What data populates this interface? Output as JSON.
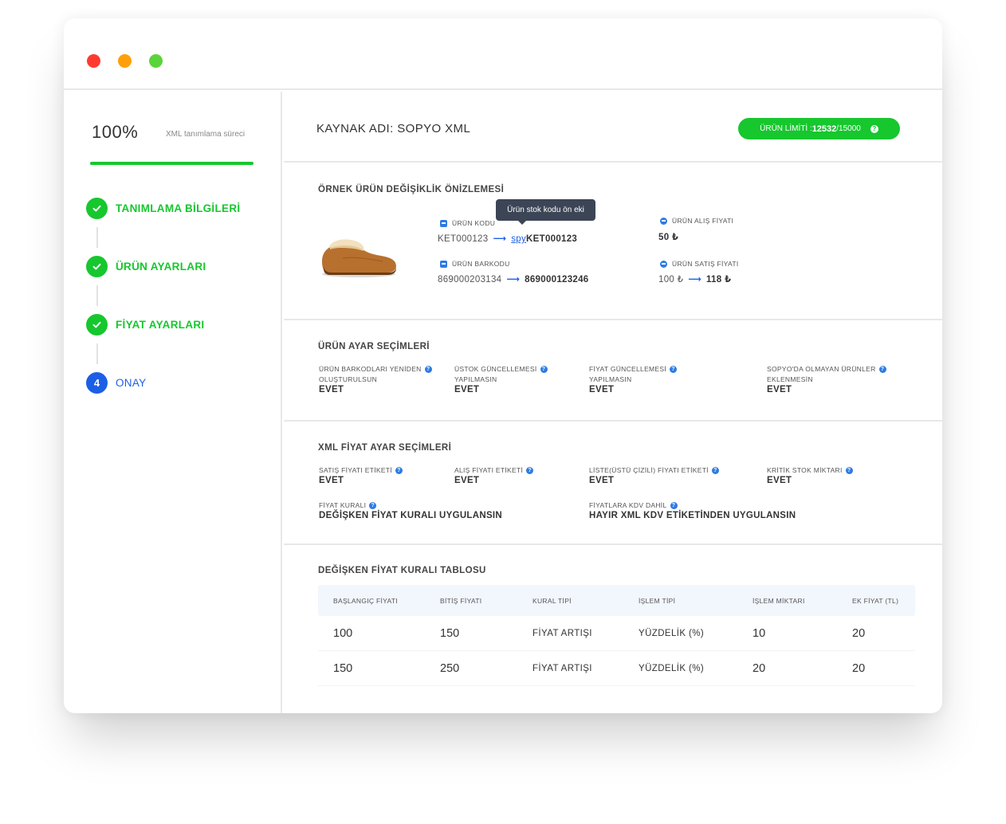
{
  "window": {
    "controls": [
      "close",
      "minimize",
      "maximize"
    ]
  },
  "sidebar": {
    "progress_percent": "100%",
    "progress_value": 100,
    "progress_label": "XML tanımlama süreci",
    "steps": [
      {
        "label": "TANIMLAMA BİLGİLERİ",
        "state": "done"
      },
      {
        "label": "ÜRÜN AYARLARI",
        "state": "done"
      },
      {
        "label": "FİYAT AYARLARI",
        "state": "done"
      },
      {
        "number": "4",
        "label": "ONAY",
        "state": "current"
      }
    ]
  },
  "header": {
    "source_title": "KAYNAK ADI: SOPYO XML",
    "limit_label": "ÜRÜN LİMİTİ : ",
    "limit_used": "12532",
    "limit_total": "/15000"
  },
  "preview": {
    "title": "ÖRNEK ÜRÜN DEĞİŞİKLİK ÖNİZLEMESİ",
    "tooltip": "Ürün stok kodu ön eki",
    "product_code": {
      "label": "ÜRÜN KODU",
      "old": "KET000123",
      "prefix": "spy",
      "new": "KET000123"
    },
    "barcode": {
      "label": "ÜRÜN BARKODU",
      "old": "869000203134",
      "new": "869000123246"
    },
    "purchase_price": {
      "label": "ÜRÜN ALIŞ FİYATI",
      "value": "50 ₺"
    },
    "sale_price": {
      "label": "ÜRÜN SATIŞ FİYATI",
      "old": "100 ₺",
      "new": "118 ₺"
    }
  },
  "product_settings": {
    "title": "ÜRÜN AYAR SEÇİMLERİ",
    "items": [
      {
        "label1": "ÜRÜN BARKODLARI YENİDEN",
        "label2": "OLUŞTURULSUN",
        "value": "EVET"
      },
      {
        "label1": "ÜSTOK GÜNCELLEMESİ",
        "label2": "YAPILMASIN",
        "value": "EVET"
      },
      {
        "label1": "FİYAT GÜNCELLEMESİ",
        "label2": "YAPILMASIN",
        "value": "EVET"
      },
      {
        "label1": "SOPYO'DA OLMAYAN ÜRÜNLER",
        "label2": "EKLENMESİN",
        "value": "EVET"
      }
    ]
  },
  "price_settings": {
    "title": "XML FİYAT AYAR SEÇİMLERİ",
    "items": [
      {
        "label": "SATIŞ FİYATI ETİKETİ",
        "value": "EVET"
      },
      {
        "label": "ALIŞ FİYATI ETİKETİ",
        "value": "EVET"
      },
      {
        "label": "LİSTE(ÜSTÜ ÇİZİLİ) FİYATI ETİKETİ",
        "value": "EVET"
      },
      {
        "label": "KRİTİK STOK MİKTARI",
        "value": "EVET"
      },
      {
        "label": "FİYAT KURALI",
        "value": "DEĞİŞKEN FİYAT KURALI UYGULANSIN"
      },
      {
        "label": "FİYATLARA KDV DAHİL",
        "value": "HAYIR XML KDV ETİKETİNDEN UYGULANSIN"
      }
    ]
  },
  "rule_table": {
    "title": "DEĞİŞKEN FİYAT KURALI TABLOSU",
    "columns": [
      "BAŞLANGIÇ FİYATI",
      "BİTİŞ FİYATI",
      "KURAL TİPİ",
      "İŞLEM TİPİ",
      "İŞLEM MİKTARI",
      "EK FİYAT (TL)"
    ],
    "rows": [
      [
        "100",
        "150",
        "FİYAT ARTIŞI",
        "YÜZDELİK (%)",
        "10",
        "20"
      ],
      [
        "150",
        "250",
        "FİYAT ARTIŞI",
        "YÜZDELİK (%)",
        "20",
        "20"
      ]
    ]
  },
  "colors": {
    "green": "#16c72e",
    "blue": "#1c5fe6",
    "close": "#ff3b30",
    "minimize": "#ff9f0a",
    "maximize": "#5ad43a"
  }
}
